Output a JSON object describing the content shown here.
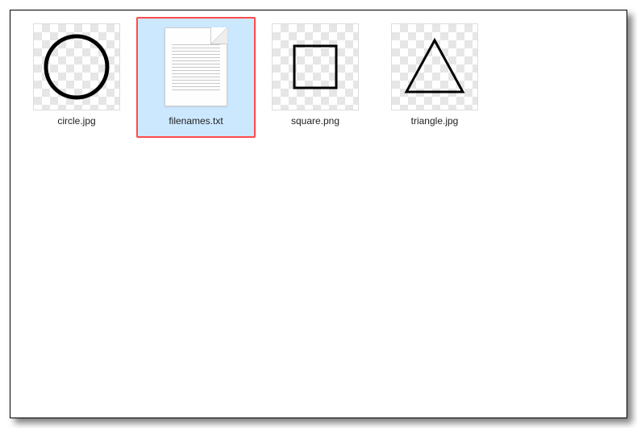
{
  "files": [
    {
      "name": "circle",
      "label": "circle.jpg",
      "type": "image-circle",
      "selected": false
    },
    {
      "name": "filenames",
      "label": "filenames.txt",
      "type": "text-document",
      "selected": true
    },
    {
      "name": "square",
      "label": "square.png",
      "type": "image-square",
      "selected": false
    },
    {
      "name": "triangle",
      "label": "triangle.jpg",
      "type": "image-triangle",
      "selected": false
    }
  ]
}
